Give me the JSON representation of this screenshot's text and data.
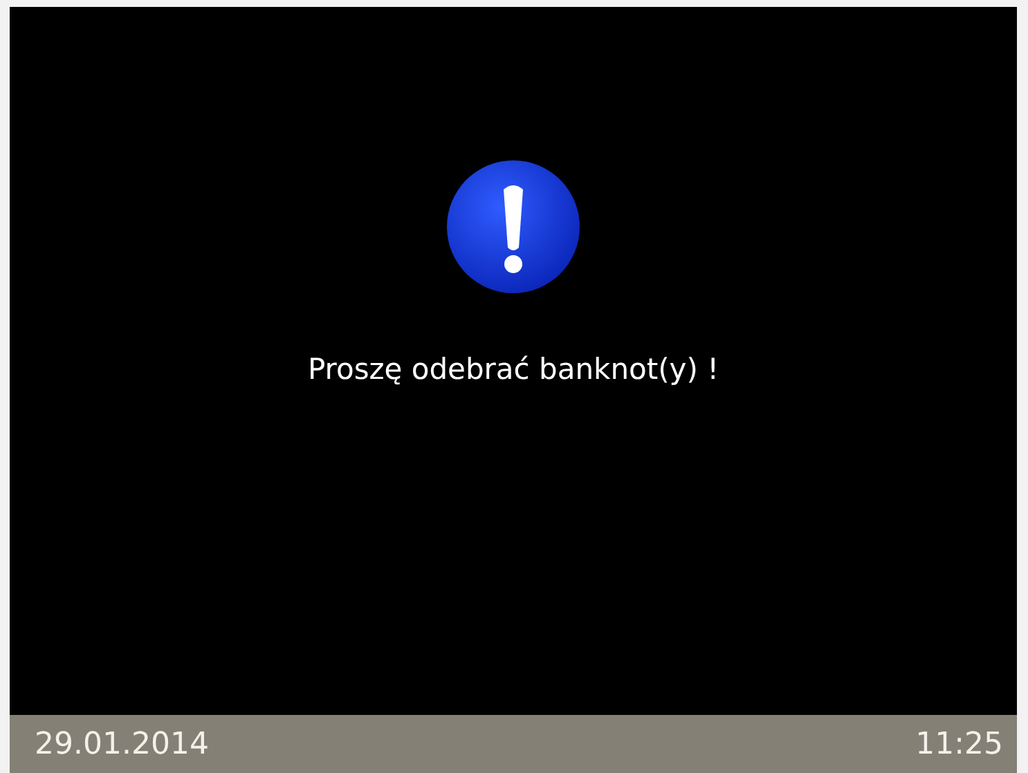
{
  "message": {
    "text": "Proszę odebrać banknot(y) !"
  },
  "status_bar": {
    "date": "29.01.2014",
    "time": "11:25"
  }
}
